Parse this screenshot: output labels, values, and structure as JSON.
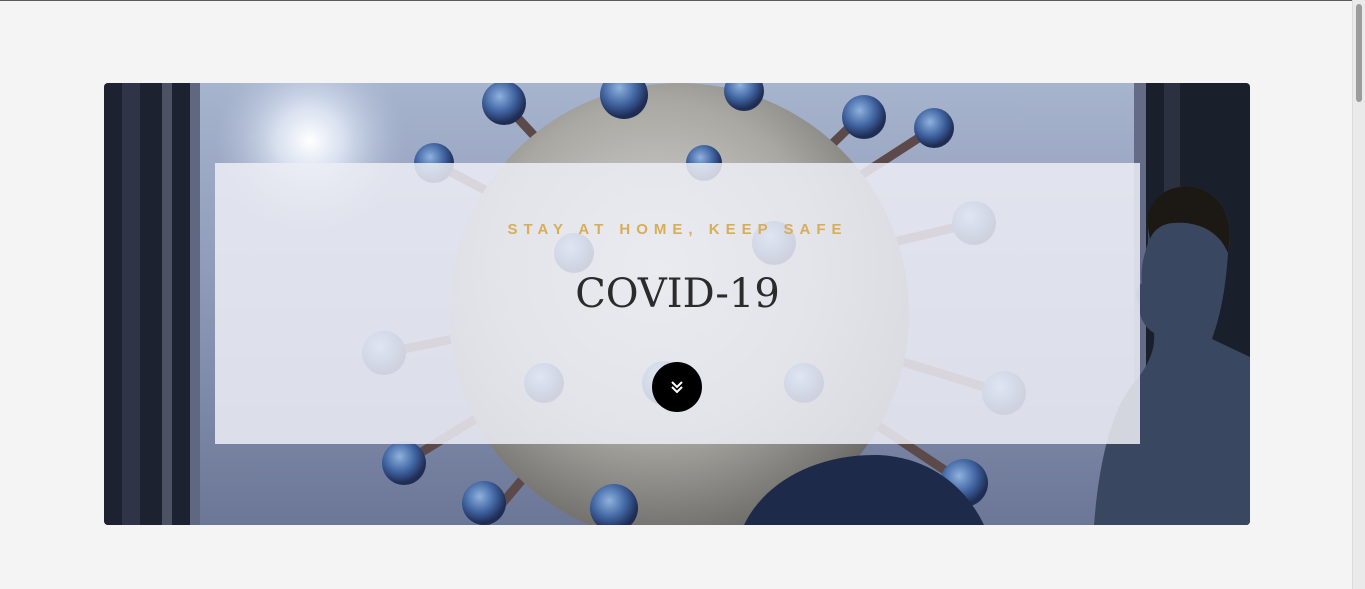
{
  "hero": {
    "tagline": "STAY AT HOME, KEEP SAFE",
    "title": "COVID-19",
    "scroll_icon": "double-chevron-down-icon"
  },
  "colors": {
    "accent": "#d9ad55",
    "title": "#2b2b2b",
    "button": "#000000",
    "page_background": "#f4f4f4"
  }
}
